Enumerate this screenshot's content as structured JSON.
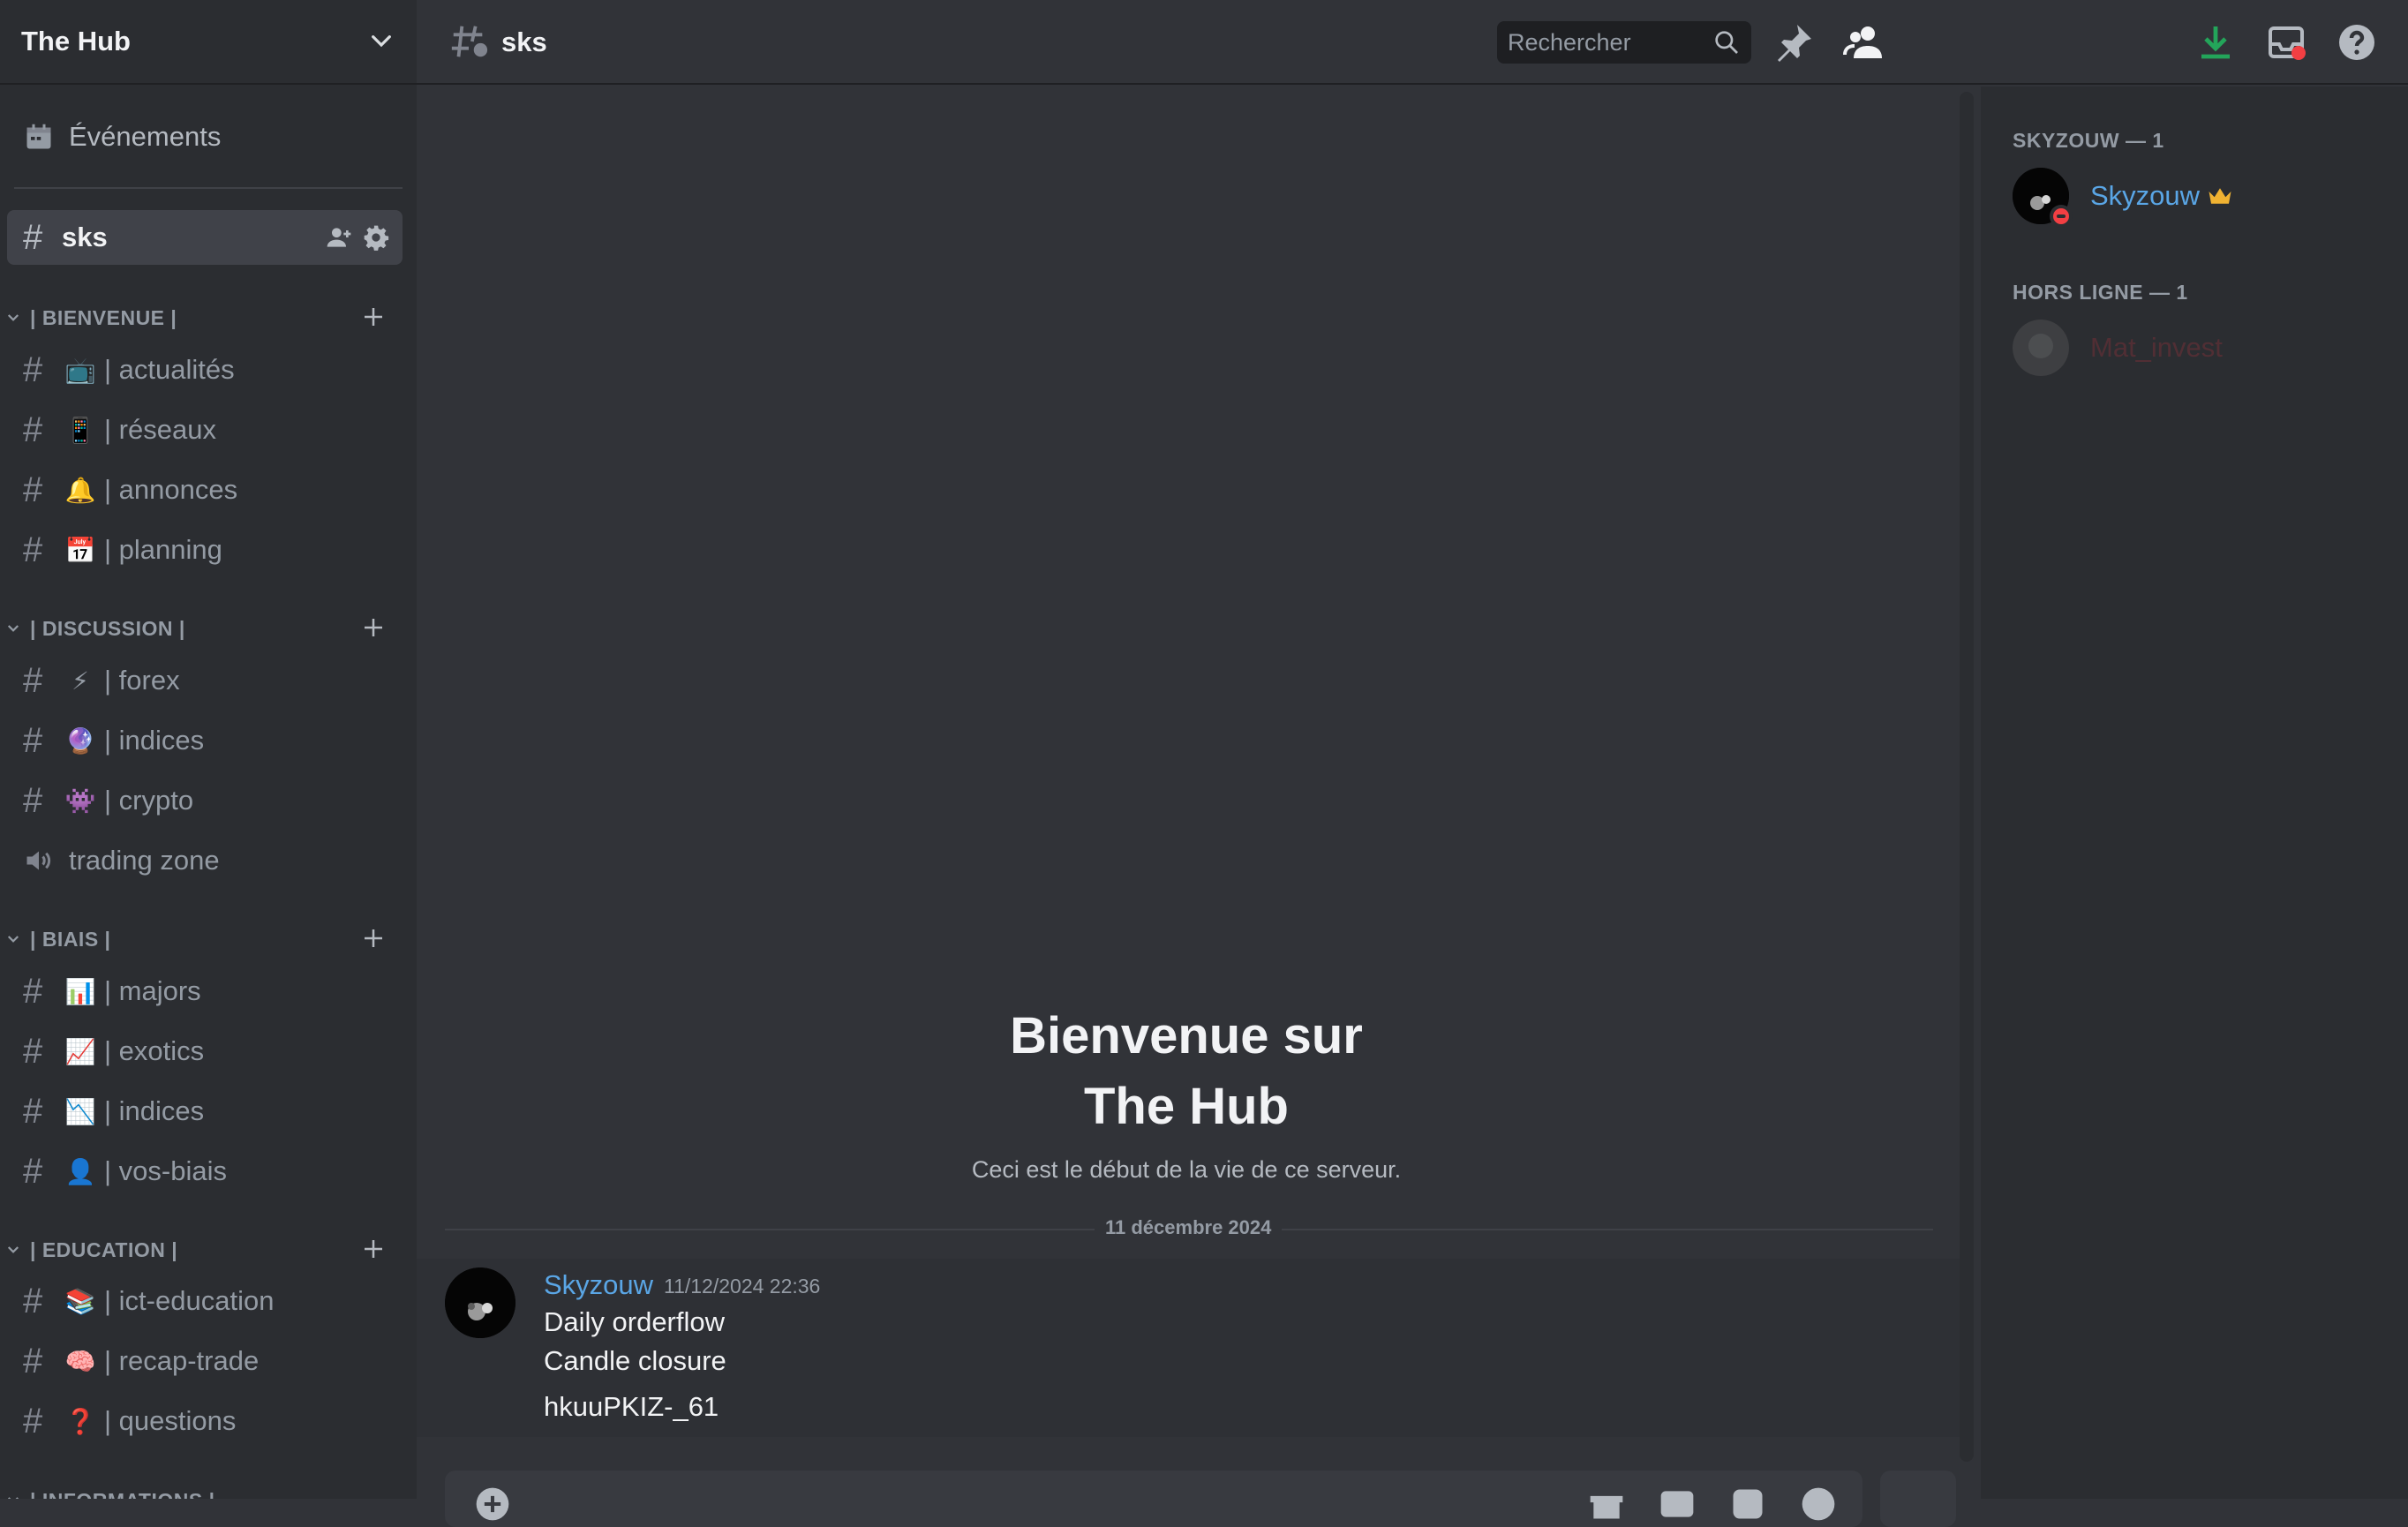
{
  "server": {
    "name": "The Hub"
  },
  "sidebar": {
    "events_label": "Événements",
    "active_channel": {
      "name": "sks"
    },
    "categories": [
      {
        "label": "| BIENVENUE |",
        "channels": [
          {
            "emoji": "📺",
            "name": "| actualités"
          },
          {
            "emoji": "📱",
            "name": "| réseaux"
          },
          {
            "emoji": "🔔",
            "name": "| annonces"
          },
          {
            "emoji": "📅",
            "name": "| planning"
          }
        ]
      },
      {
        "label": "| DISCUSSION |",
        "channels": [
          {
            "emoji": "⚡",
            "name": "| forex"
          },
          {
            "emoji": "🔮",
            "name": "| indices"
          },
          {
            "emoji": "👾",
            "name": "| crypto"
          }
        ],
        "voice_channel": "trading zone"
      },
      {
        "label": "| BIAIS |",
        "channels": [
          {
            "emoji": "📊",
            "name": "| majors"
          },
          {
            "emoji": "📈",
            "name": "| exotics"
          },
          {
            "emoji": "📉",
            "name": "| indices"
          },
          {
            "emoji": "👤",
            "name": "| vos-biais"
          }
        ]
      },
      {
        "label": "| EDUCATION |",
        "channels": [
          {
            "emoji": "📚",
            "name": "| ict-education"
          },
          {
            "emoji": "🧠",
            "name": "| recap-trade"
          },
          {
            "emoji": "❓",
            "name": "| questions"
          }
        ]
      },
      {
        "label": "| INFORMATIONS |"
      }
    ]
  },
  "header": {
    "channel_name": "sks",
    "search_placeholder": "Rechercher",
    "icons": [
      "threads-icon",
      "bell-icon",
      "pin-icon",
      "members-icon",
      "download-icon",
      "inbox-icon",
      "help-icon"
    ]
  },
  "chat": {
    "welcome_line1": "Bienvenue sur",
    "welcome_line2": "The Hub",
    "welcome_sub": "Ceci est le début de la vie de ce serveur.",
    "date_divider": "11 décembre 2024",
    "message": {
      "author": "Skyzouw",
      "timestamp": "11/12/2024 22:36",
      "lines": [
        "Daily orderflow",
        "Candle closure",
        "hkuuPKIZ-_61"
      ]
    }
  },
  "members": {
    "groups": [
      {
        "label": "SKYZOUW — 1",
        "members": [
          {
            "name": "Skyzouw",
            "owner": true,
            "status": "dnd"
          }
        ]
      },
      {
        "label": "HORS LIGNE — 1",
        "members": [
          {
            "name": "Mat_invest",
            "owner": false,
            "status": "offline"
          }
        ]
      }
    ]
  },
  "colors": {
    "background": "#313338",
    "sidebar": "#2b2d31",
    "username": "#5aa6e6",
    "dnd": "#f23f43",
    "download": "#23a55a",
    "crown": "#f0b232"
  }
}
